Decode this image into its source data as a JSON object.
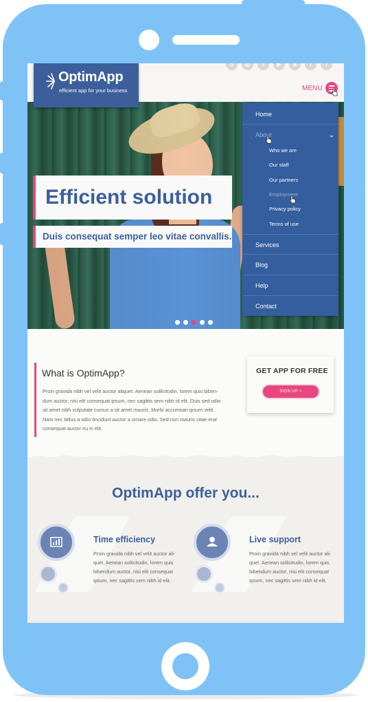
{
  "brand": {
    "name": "OptimApp",
    "tagline": "efficient app for your business"
  },
  "header": {
    "menu_label": "MENU"
  },
  "social_icons": [
    "skype-icon",
    "dribbble-icon",
    "vimeo-icon",
    "youtube-icon",
    "instagram-icon",
    "twitter-icon",
    "facebook-icon"
  ],
  "hero": {
    "title": "Efficient solution",
    "subtitle": "Duis consequat semper leo vitae convallis.",
    "slides": 5,
    "active_slide": 3
  },
  "menu": {
    "items": [
      {
        "label": "Home"
      },
      {
        "label": "About",
        "expanded": true,
        "children": [
          "Who we are",
          "Our staff",
          "Our partners",
          "Employment",
          "Privacy policy",
          "Terms of use"
        ]
      },
      {
        "label": "Services"
      },
      {
        "label": "Blog"
      },
      {
        "label": "Help"
      },
      {
        "label": "Contact"
      }
    ]
  },
  "info": {
    "title": "What is OptimApp?",
    "body_lines": [
      "Proin gravida nibh vel velit auctor aliquet. Aenean sollicitudin, lorem quis biben-",
      "dum auctor, nisi elit consequat ipsum, nec sagittis sem nibh id elit. Duis sed odio",
      "sit amet nibh vulputate cursus a sit amet mauris. Morbi accumsan ipsum velit.",
      "Nam nec tellus a odio tincidunt auctor a ornare odio. Sed non  mauris vitae erat",
      "consequat auctor eu in elit."
    ],
    "cta_title": "GET APP FOR FREE",
    "cta_button": "SIGN UP  >"
  },
  "offer": {
    "title": "OptimApp offer you...",
    "features": [
      {
        "title": "Time efficiency",
        "icon": "chart-icon",
        "lines": [
          "Proin gravida nibh vel velit auctor ali-",
          "quet. Aenean sollicitudin, lorem quis",
          "bibendum auctor, nisi elit consequat",
          "ipsum, nec sagittis sem nibh id elit."
        ]
      },
      {
        "title": "Live support",
        "icon": "user-icon",
        "lines": [
          "Proin gravida nibh vel velit auctor ali-",
          "quet. Aenean sollicitudin, lorem quis",
          "bibendum auctor, nisi elit consequat",
          "ipsum, nec sagittis sem nibh id elit."
        ]
      }
    ]
  },
  "colors": {
    "phone": "#7fc3f6",
    "brand_blue": "#3c5f9c",
    "menu_blue": "#345e9e",
    "accent_pink": "#e9457e"
  }
}
